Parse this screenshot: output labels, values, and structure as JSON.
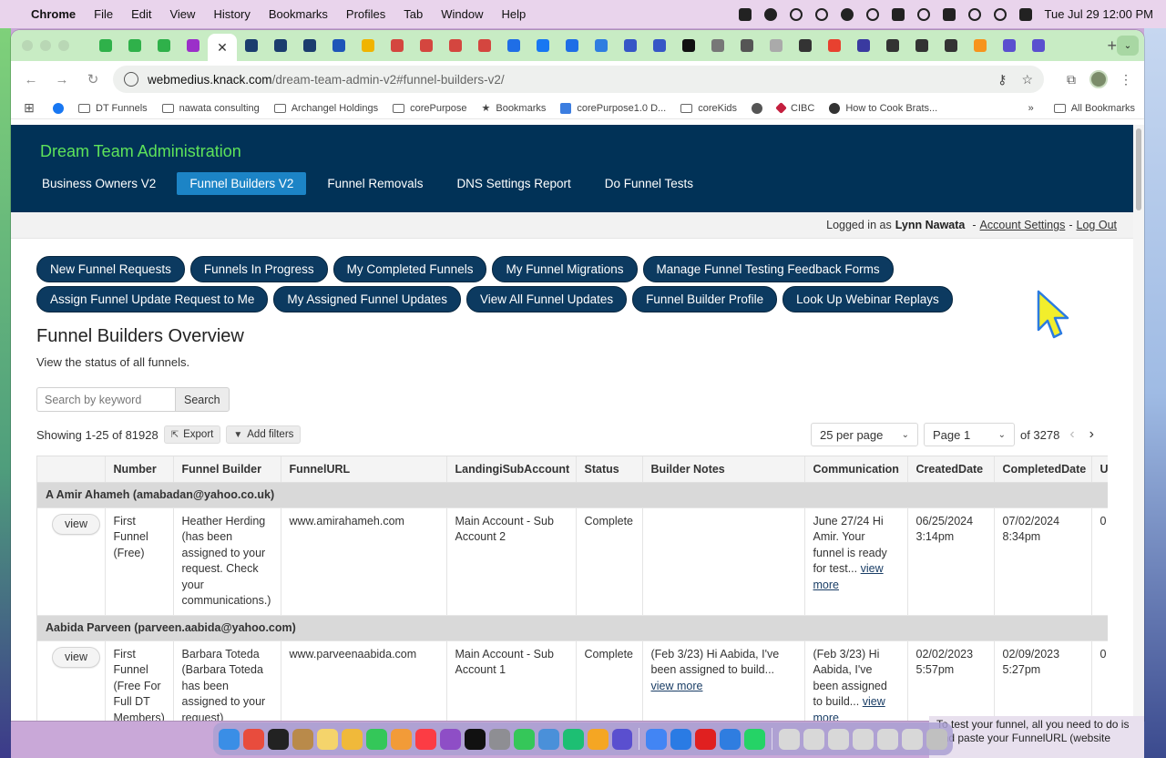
{
  "menubar": {
    "app": "Chrome",
    "items": [
      "File",
      "Edit",
      "View",
      "History",
      "Bookmarks",
      "Profiles",
      "Tab",
      "Window",
      "Help"
    ],
    "clock": "Tue Jul 29  12:00 PM"
  },
  "browser": {
    "url_host": "webmedius.knack.com",
    "url_path": "/dream-team-admin-v2#funnel-builders-v2/",
    "bookmarks": [
      "DT Funnels",
      "nawata consulting",
      "Archangel Holdings",
      "corePurpose",
      "Bookmarks",
      "corePurpose1.0 D...",
      "coreKids",
      "CIBC",
      "How to Cook Brats..."
    ],
    "all_bookmarks": "All Bookmarks"
  },
  "site": {
    "title": "Dream Team Administration",
    "nav": [
      "Business Owners V2",
      "Funnel Builders V2",
      "Funnel Removals",
      "DNS Settings Report",
      "Do Funnel Tests"
    ],
    "active_nav": "Funnel Builders V2"
  },
  "userbar": {
    "prefix": "Logged in as",
    "user": "Lynn Nawata",
    "account_settings": "Account Settings",
    "logout": "Log Out",
    "sep": "-"
  },
  "pills_row1": [
    "New Funnel Requests",
    "Funnels In Progress",
    "My Completed Funnels",
    "My Funnel Migrations",
    "Manage Funnel Testing Feedback Forms"
  ],
  "pills_row2": [
    "Assign Funnel Update Request to Me",
    "My Assigned Funnel Updates",
    "View All Funnel Updates",
    "Funnel Builder Profile",
    "Look Up Webinar Replays"
  ],
  "page": {
    "title": "Funnel Builders Overview",
    "subtitle": "View the status of all funnels."
  },
  "search": {
    "placeholder": "Search by keyword",
    "button": "Search"
  },
  "list": {
    "showing": "Showing 1-25 of 81928",
    "export": "Export",
    "add_filters": "Add filters",
    "per_page": "25 per page",
    "page": "Page 1",
    "of_pages": "of 3278"
  },
  "table": {
    "headers": [
      "",
      "Number",
      "Funnel Builder",
      "FunnelURL",
      "LandingiSubAccount",
      "Status",
      "Builder Notes",
      "Communication",
      "CreatedDate",
      "CompletedDate",
      "U"
    ],
    "view_label": "view",
    "view_more": "view more",
    "groups": [
      {
        "name": "A Amir Ahameh (amabadan@yahoo.co.uk)",
        "row": {
          "number": "First Funnel (Free)",
          "builder": "Heather Herding (has been assigned to your request. Check your communications.)",
          "url": "www.amirahameh.com",
          "subaccount": "Main Account - Sub Account 2",
          "status": "Complete",
          "notes": "",
          "communication": "June 27/24 Hi Amir. Your funnel is ready for test...",
          "created_date": "06/25/2024",
          "created_time": "3:14pm",
          "completed_date": "07/02/2024",
          "completed_time": "8:34pm",
          "u": "0"
        }
      },
      {
        "name": "Aabida Parveen (parveen.aabida@yahoo.com)",
        "row": {
          "number": "First Funnel (Free For Full DT Members)",
          "builder": "Barbara Toteda (Barbara Toteda has been assigned to your request)",
          "url": "www.parveenaabida.com",
          "subaccount": "Main Account - Sub Account 1",
          "status": "Complete",
          "notes": "(Feb 3/23) Hi Aabida, I've been assigned to build...",
          "communication": "(Feb 3/23) Hi Aabida, I've been assigned to build...",
          "created_date": "02/02/2023",
          "created_time": "5:57pm",
          "completed_date": "02/09/2023",
          "completed_time": "5:27pm",
          "u": "0"
        }
      }
    ]
  },
  "peek_text": "To test your funnel, all you need to do is and paste your FunnelURL (website",
  "colors": {
    "header_bg": "#013257",
    "title_green": "#5ee35a",
    "nav_active": "#1c84c6",
    "pill_bg": "#0c3a60",
    "cursor": "#f2ee2c"
  }
}
